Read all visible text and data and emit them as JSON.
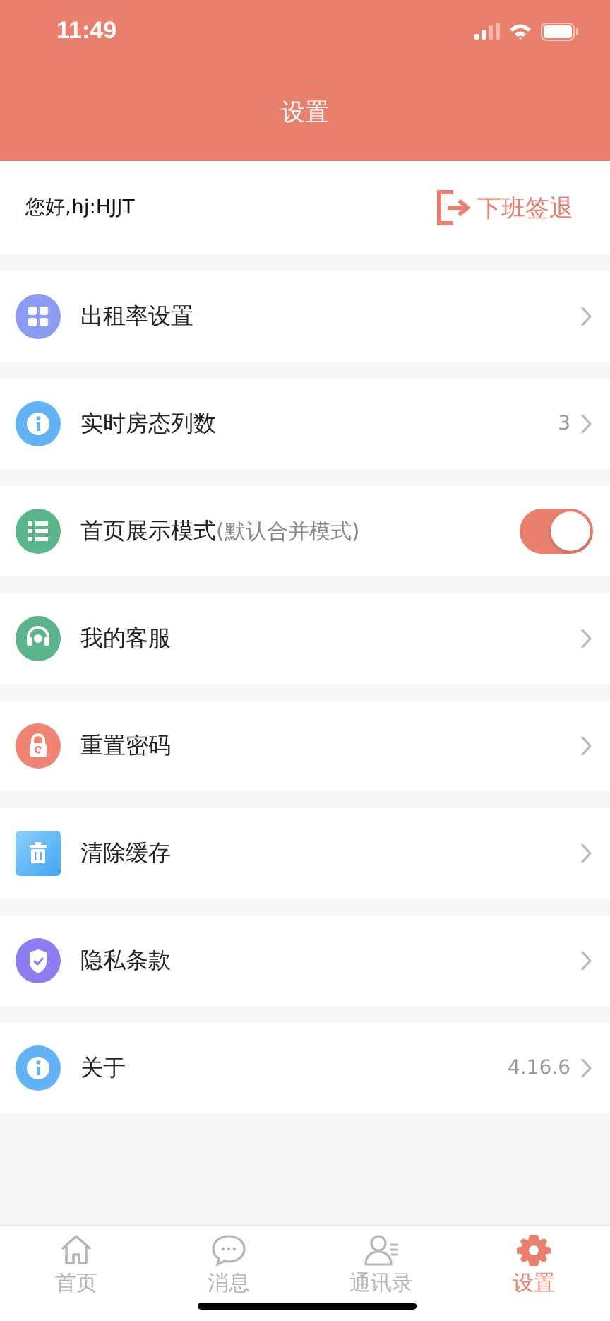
{
  "status_bar": {
    "time": "11:49"
  },
  "header": {
    "title": "设置"
  },
  "user": {
    "greeting": "您好,hj:HJJT",
    "action": "下班签退"
  },
  "settings": [
    {
      "kind": "link",
      "label": "出租率设置"
    },
    {
      "kind": "link",
      "label": "实时房态列数",
      "value": "3"
    },
    {
      "kind": "toggle",
      "label": "首页展示模式",
      "note": "(默认合并模式)",
      "on": true
    },
    {
      "kind": "link",
      "label": "我的客服"
    },
    {
      "kind": "link",
      "label": "重置密码"
    },
    {
      "kind": "link",
      "label": "清除缓存"
    },
    {
      "kind": "link",
      "label": "隐私条款"
    },
    {
      "kind": "link",
      "label": "关于",
      "value": "4.16.6"
    }
  ],
  "tab_bar": [
    {
      "label": "首页",
      "selected": false
    },
    {
      "label": "消息",
      "selected": false
    },
    {
      "label": "通讯录",
      "selected": false
    },
    {
      "label": "设置",
      "selected": true
    }
  ]
}
